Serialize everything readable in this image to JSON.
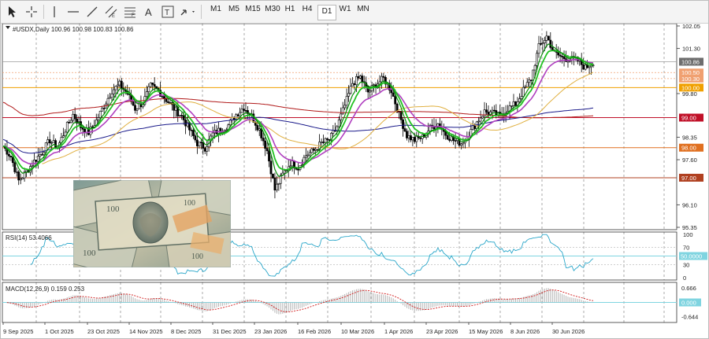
{
  "toolbar": {
    "timeframes": [
      "M1",
      "M5",
      "M15",
      "M30",
      "H1",
      "H4",
      "D1",
      "W1",
      "MN"
    ],
    "active_timeframe": "D1",
    "tools": [
      "cursor-arrow",
      "crosshair",
      "vertical-line",
      "horizontal-line",
      "trend-line",
      "equidistant-channel",
      "fibonacci",
      "text-label",
      "arrows-dropdown"
    ]
  },
  "chart_data": {
    "type": "candlestick",
    "symbol_header": "#USDX,Daily  100.96 100.98 100.83 100.86",
    "price_axis_labels": [
      "102.05",
      "101.30",
      "100.86",
      "100.50",
      "100.30",
      "100.00",
      "99.80",
      "99.00",
      "98.35",
      "98.00",
      "97.60",
      "97.00",
      "96.10",
      "95.35"
    ],
    "price_ylim": [
      95.35,
      102.05
    ],
    "x_labels": [
      "9 Sep 2025",
      "1 Oct 2025",
      "23 Oct 2025",
      "14 Nov 2025",
      "8 Dec 2025",
      "31 Dec 2025",
      "23 Jan 2026",
      "16 Feb 2026",
      "10 Mar 2026",
      "1 Apr 2026",
      "23 Apr 2026",
      "15 May 2026",
      "8 Jun 2026",
      "30 Jun 2026"
    ],
    "current_price": "100.86",
    "horizontal_levels": [
      {
        "label": "100.50",
        "value": 100.5,
        "color": "#f0a070",
        "style": "dotted"
      },
      {
        "label": "100.30",
        "value": 100.3,
        "color": "#f0a070",
        "style": "dotted"
      },
      {
        "label": "100.00",
        "value": 100.0,
        "color": "#f0a000",
        "style": "solid"
      },
      {
        "label": "99.00",
        "value": 99.0,
        "color": "#c01028",
        "style": "solid"
      },
      {
        "label": "98.00",
        "value": 98.0,
        "color": "#e07020",
        "style": "solid"
      },
      {
        "label": "97.00",
        "value": 97.0,
        "color": "#b04020",
        "style": "solid"
      }
    ],
    "close_path": [
      [
        0,
        98.05
      ],
      [
        4,
        97.7
      ],
      [
        8,
        96.9
      ],
      [
        12,
        97.2
      ],
      [
        16,
        97.55
      ],
      [
        20,
        97.85
      ],
      [
        24,
        98.25
      ],
      [
        28,
        98.0
      ],
      [
        32,
        98.6
      ],
      [
        36,
        99.1
      ],
      [
        40,
        98.7
      ],
      [
        44,
        98.5
      ],
      [
        48,
        98.9
      ],
      [
        52,
        99.4
      ],
      [
        56,
        99.9
      ],
      [
        60,
        100.1
      ],
      [
        64,
        99.8
      ],
      [
        68,
        99.3
      ],
      [
        72,
        99.5
      ],
      [
        76,
        100.05
      ],
      [
        80,
        99.9
      ],
      [
        84,
        99.6
      ],
      [
        88,
        99.3
      ],
      [
        92,
        99.05
      ],
      [
        96,
        98.6
      ],
      [
        100,
        98.15
      ],
      [
        104,
        98.0
      ],
      [
        108,
        98.45
      ],
      [
        112,
        98.6
      ],
      [
        116,
        98.75
      ],
      [
        120,
        99.1
      ],
      [
        124,
        99.35
      ],
      [
        128,
        99.05
      ],
      [
        132,
        98.6
      ],
      [
        136,
        97.9
      ],
      [
        140,
        96.6
      ],
      [
        144,
        97.1
      ],
      [
        148,
        97.5
      ],
      [
        152,
        97.35
      ],
      [
        156,
        97.75
      ],
      [
        160,
        97.9
      ],
      [
        164,
        98.15
      ],
      [
        168,
        98.25
      ],
      [
        172,
        98.7
      ],
      [
        176,
        99.4
      ],
      [
        180,
        100.15
      ],
      [
        184,
        100.35
      ],
      [
        188,
        99.85
      ],
      [
        192,
        100.1
      ],
      [
        196,
        100.3
      ],
      [
        200,
        99.9
      ],
      [
        204,
        99.1
      ],
      [
        208,
        98.4
      ],
      [
        212,
        98.25
      ],
      [
        216,
        98.35
      ],
      [
        220,
        98.65
      ],
      [
        224,
        98.8
      ],
      [
        228,
        98.45
      ],
      [
        232,
        98.25
      ],
      [
        236,
        98.15
      ],
      [
        240,
        98.45
      ],
      [
        244,
        98.85
      ],
      [
        248,
        99.2
      ],
      [
        252,
        99.15
      ],
      [
        256,
        99.05
      ],
      [
        260,
        99.3
      ],
      [
        264,
        99.45
      ],
      [
        268,
        99.9
      ],
      [
        272,
        100.3
      ],
      [
        276,
        101.35
      ],
      [
        280,
        101.7
      ],
      [
        284,
        101.15
      ],
      [
        288,
        101.0
      ],
      [
        292,
        100.95
      ],
      [
        296,
        100.9
      ],
      [
        300,
        100.65
      ],
      [
        304,
        100.86
      ]
    ],
    "overlays": [
      {
        "name": "EMA fast",
        "color": "#0a8a0a"
      },
      {
        "name": "EMA fast 2",
        "color": "#22c222"
      },
      {
        "name": "EMA slow",
        "color": "#b040c0"
      },
      {
        "name": "SMA 50",
        "color": "#e0b040"
      },
      {
        "name": "SMA 100",
        "color": "#1a1a8a"
      },
      {
        "name": "SMA 200",
        "color": "#b01818"
      }
    ],
    "rsi": {
      "label": "RSI(14) 53.4066",
      "axis_labels": [
        "100",
        "70",
        "50.0000",
        "30",
        "0"
      ],
      "level_label": "50.0000"
    },
    "macd": {
      "label": "MACD(12,26,9) 0.159 0.253",
      "axis_labels": [
        "0.666",
        "0.000",
        "-0.644"
      ],
      "zero_label": "0.000"
    }
  }
}
